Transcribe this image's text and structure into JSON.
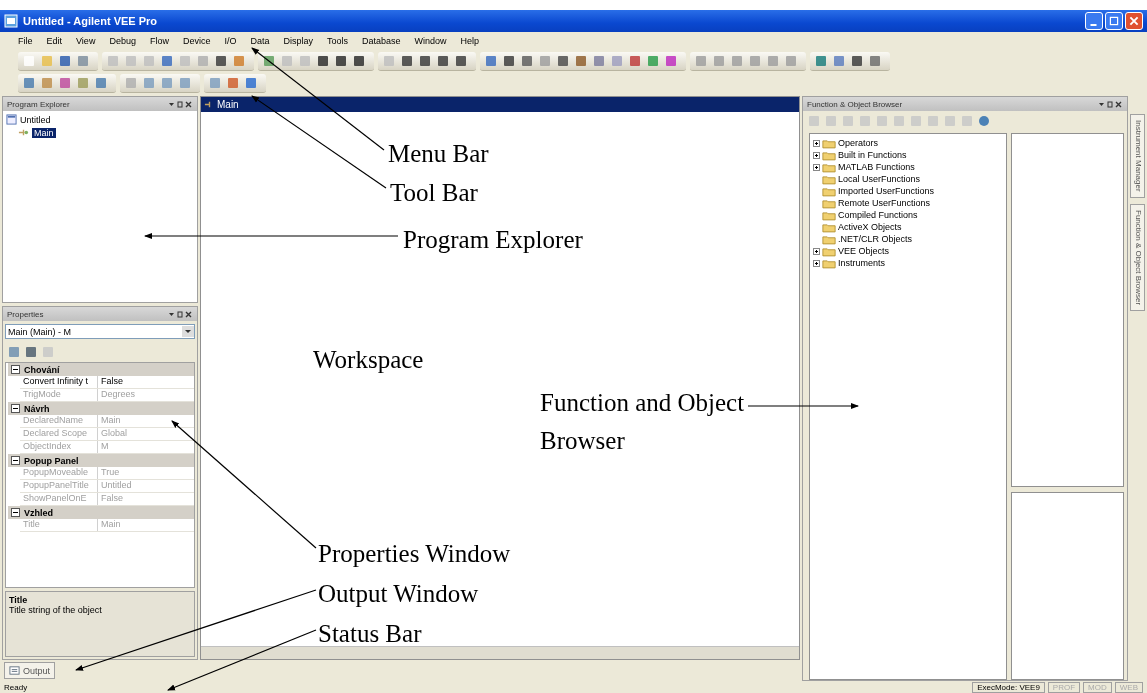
{
  "window": {
    "title": "Untitled - Agilent VEE Pro"
  },
  "menu": [
    "File",
    "Edit",
    "View",
    "Debug",
    "Flow",
    "Device",
    "I/O",
    "Data",
    "Display",
    "Tools",
    "Database",
    "Window",
    "Help"
  ],
  "program_explorer": {
    "title": "Program Explorer",
    "tree": [
      {
        "label": "Untitled",
        "children": [
          {
            "label": "Main",
            "selected": true
          }
        ]
      }
    ]
  },
  "properties": {
    "title": "Properties",
    "object": "Main (Main) - M",
    "categories": [
      {
        "name": "Chování",
        "rows": [
          {
            "name": "Convert Infinity t",
            "value": "False",
            "disabled": false
          },
          {
            "name": "TrigMode",
            "value": "Degrees",
            "disabled": true
          }
        ]
      },
      {
        "name": "Návrh",
        "rows": [
          {
            "name": "DeclaredName",
            "value": "Main",
            "disabled": true
          },
          {
            "name": "Declared Scope",
            "value": "Global",
            "disabled": true
          },
          {
            "name": "ObjectIndex",
            "value": "M",
            "disabled": true
          }
        ]
      },
      {
        "name": "Popup Panel",
        "rows": [
          {
            "name": "PopupMoveable",
            "value": "True",
            "disabled": true
          },
          {
            "name": "PopupPanelTitle",
            "value": "Untitled",
            "disabled": true
          },
          {
            "name": "ShowPanelOnE",
            "value": "False",
            "disabled": true
          }
        ]
      },
      {
        "name": "Vzhled",
        "rows": [
          {
            "name": "Title",
            "value": "Main",
            "disabled": true
          }
        ]
      }
    ],
    "help_title": "Title",
    "help_text": "Title string of the object"
  },
  "output_tab": "Output",
  "workspace": {
    "tab": "Main"
  },
  "function_browser": {
    "title": "Function & Object Browser",
    "tree": [
      {
        "label": "Operators",
        "kind": "group"
      },
      {
        "label": "Built in Functions",
        "kind": "group"
      },
      {
        "label": "MATLAB Functions",
        "kind": "group"
      },
      {
        "label": "Local UserFunctions",
        "kind": "folder"
      },
      {
        "label": "Imported UserFunctions",
        "kind": "folder"
      },
      {
        "label": "Remote UserFunctions",
        "kind": "folder"
      },
      {
        "label": "Compiled Functions",
        "kind": "folder"
      },
      {
        "label": "ActiveX Objects",
        "kind": "folder"
      },
      {
        "label": ".NET/CLR Objects",
        "kind": "folder"
      },
      {
        "label": "VEE Objects",
        "kind": "group"
      },
      {
        "label": "Instruments",
        "kind": "group"
      }
    ]
  },
  "side_tabs": [
    "Instrument Manager",
    "Function & Object Browser"
  ],
  "status_bar": {
    "text": "Ready",
    "exec_mode": "ExecMode: VEE9",
    "indicators": [
      "PROF",
      "MOD",
      "WEB"
    ]
  },
  "annotations": [
    "Menu Bar",
    "Tool Bar",
    "Program Explorer",
    "Workspace",
    "Function and Object Browser",
    "Properties Window",
    "Output Window",
    "Status Bar"
  ]
}
